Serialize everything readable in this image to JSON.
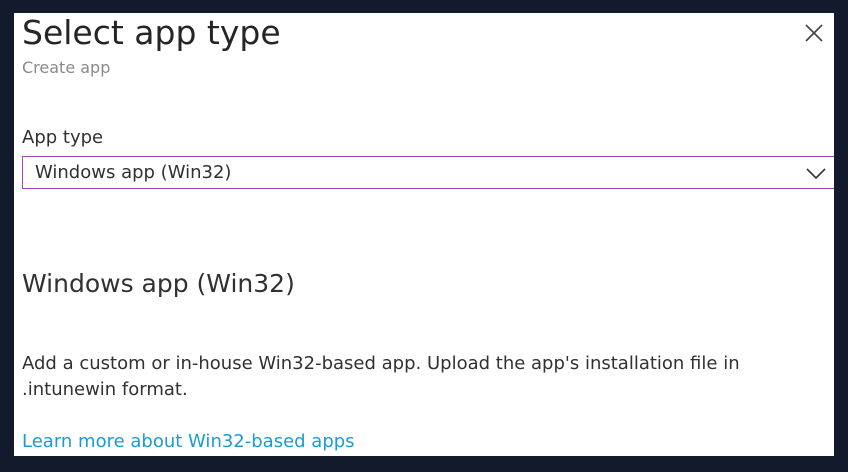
{
  "header": {
    "title": "Select app type",
    "subtitle": "Create app",
    "close_icon": "close-icon"
  },
  "form": {
    "app_type_label": "App type",
    "app_type_selected": "Windows app (Win32)",
    "dropdown_icon": "chevron-down-icon",
    "accent_color": "#a24bb8"
  },
  "details": {
    "heading": "Windows app (Win32)",
    "description": "Add a custom or in-house Win32-based app. Upload the app's installation file in .intunewin format.",
    "learn_more_link": "Learn more about Win32-based apps",
    "link_color": "#1b9bd6"
  }
}
